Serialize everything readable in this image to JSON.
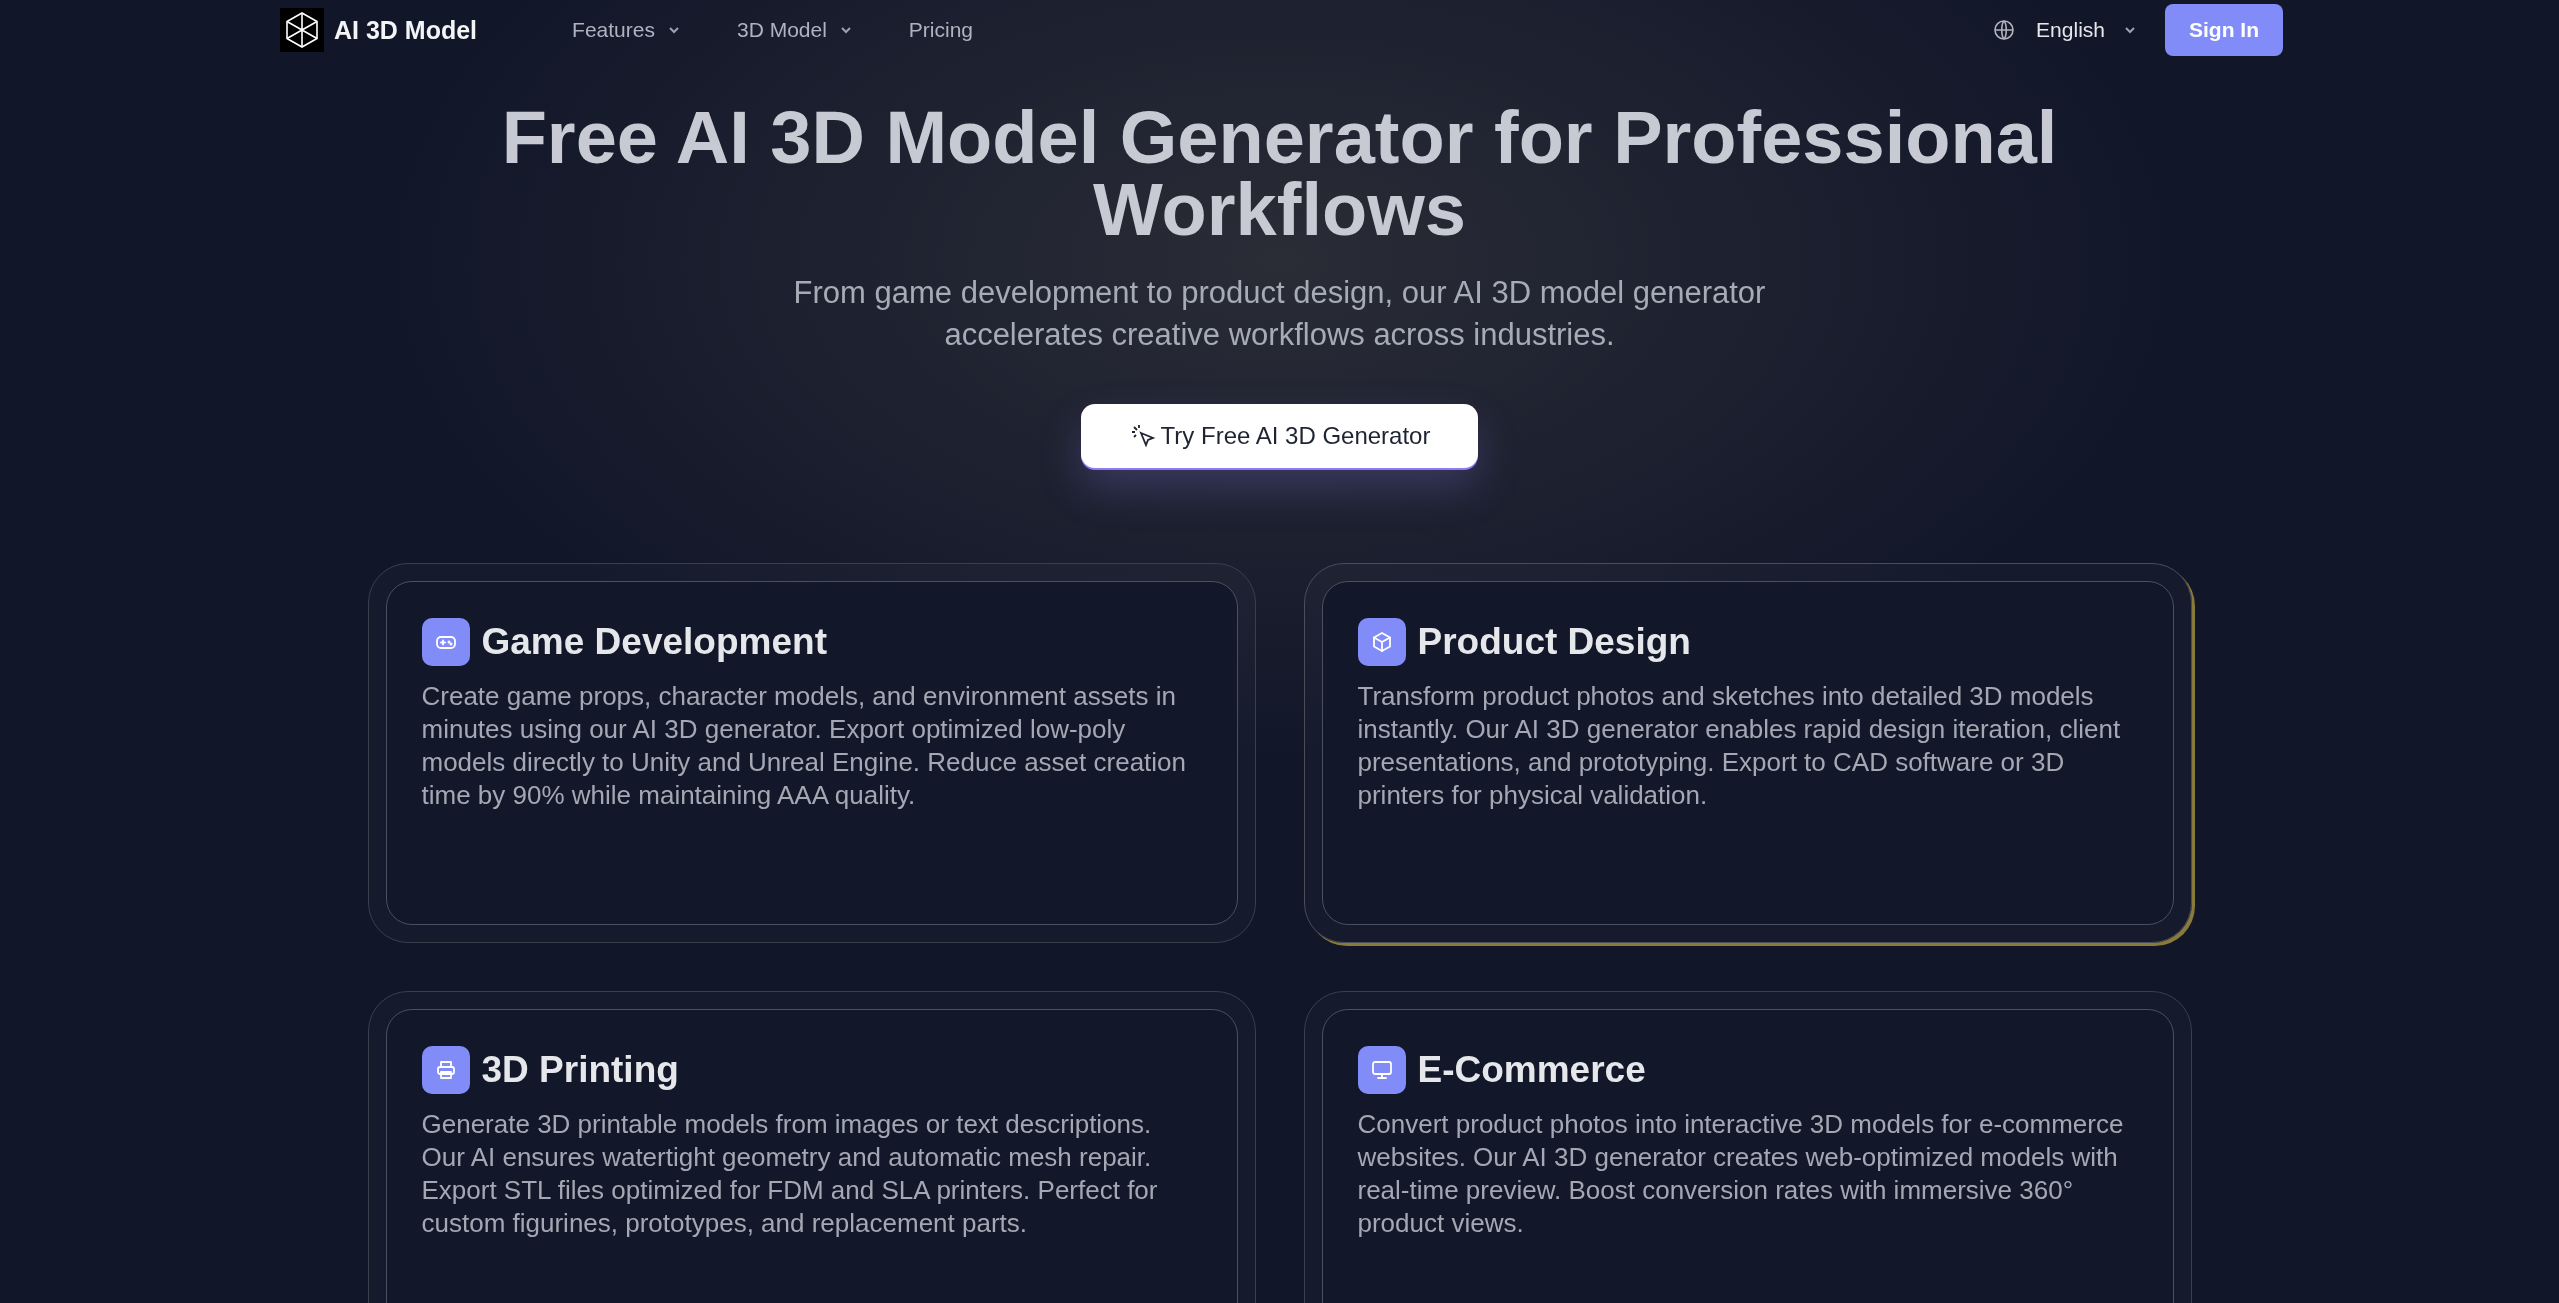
{
  "header": {
    "brand": "AI 3D Model",
    "nav": [
      {
        "label": "Features",
        "dropdown": true
      },
      {
        "label": "3D Model",
        "dropdown": true
      },
      {
        "label": "Pricing",
        "dropdown": false
      }
    ],
    "language": "English",
    "sign_in": "Sign In"
  },
  "hero": {
    "title": "Free AI 3D Model Generator for Professional Workflows",
    "subtitle": "From game development to product design, our AI 3D model generator accelerates creative workflows across industries.",
    "cta": "Try Free AI 3D Generator"
  },
  "cards": [
    {
      "kind": "gamepad",
      "title": "Game Development",
      "text": "Create game props, character models, and environment assets in minutes using our AI 3D generator. Export optimized low-poly models directly to Unity and Unreal Engine. Reduce asset creation time by 90% while maintaining AAA quality.",
      "selected": false
    },
    {
      "kind": "cube",
      "title": "Product Design",
      "text": "Transform product photos and sketches into detailed 3D models instantly. Our AI 3D generator enables rapid design iteration, client presentations, and prototyping. Export to CAD software or 3D printers for physical validation.",
      "selected": true
    },
    {
      "kind": "printer",
      "title": "3D Printing",
      "text": "Generate 3D printable models from images or text descriptions. Our AI ensures watertight geometry and automatic mesh repair. Export STL files optimized for FDM and SLA printers. Perfect for custom figurines, prototypes, and replacement parts.",
      "selected": false
    },
    {
      "kind": "monitor",
      "title": "E-Commerce",
      "text": "Convert product photos into interactive 3D models for e-commerce websites. Our AI 3D generator creates web-optimized models with real-time preview. Boost conversion rates with immersive 360° product views.",
      "selected": false
    }
  ]
}
